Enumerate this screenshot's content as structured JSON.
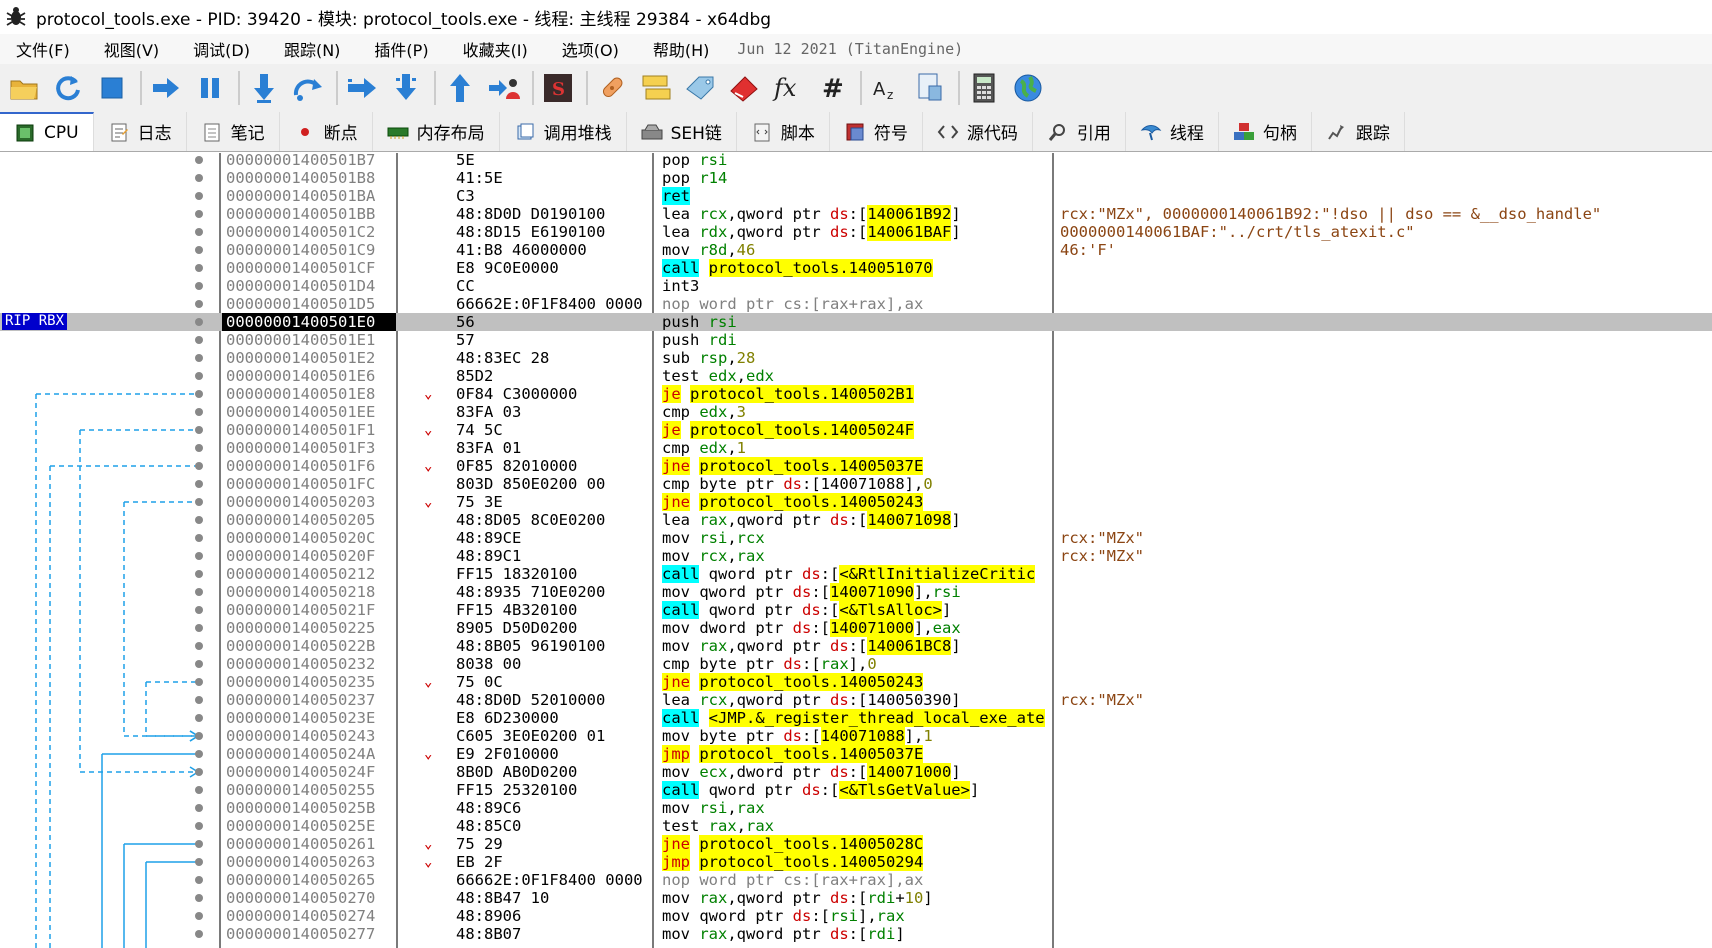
{
  "window": {
    "title": "protocol_tools.exe - PID: 39420 - 模块: protocol_tools.exe - 线程: 主线程 29384 - x64dbg"
  },
  "menu": {
    "items": [
      "文件(F)",
      "视图(V)",
      "调试(D)",
      "跟踪(N)",
      "插件(P)",
      "收藏夹(I)",
      "选项(O)",
      "帮助(H)"
    ],
    "build_info": "Jun 12 2021 (TitanEngine)"
  },
  "toolbar": {
    "icons": [
      "open-icon",
      "restart-icon",
      "stop-icon",
      "run-icon",
      "pause-icon",
      "step-into-icon",
      "step-over-icon",
      "run-to-user-icon",
      "step-into-trace-icon",
      "run-until-return-icon",
      "run-to-user-code-icon",
      "scylla-icon",
      "patch-icon",
      "comment-icon",
      "label-icon",
      "bookmark-icon",
      "function-icon",
      "hash-icon",
      "font-icon",
      "calculator-doc-icon",
      "calculator-icon",
      "globe-icon"
    ]
  },
  "tabs": [
    {
      "label": "CPU",
      "icon": "cpu-icon",
      "active": true
    },
    {
      "label": "日志",
      "icon": "log-icon"
    },
    {
      "label": "笔记",
      "icon": "notes-icon"
    },
    {
      "label": "断点",
      "icon": "breakpoint-icon"
    },
    {
      "label": "内存布局",
      "icon": "memory-icon"
    },
    {
      "label": "调用堆栈",
      "icon": "callstack-icon"
    },
    {
      "label": "SEH链",
      "icon": "seh-icon"
    },
    {
      "label": "脚本",
      "icon": "script-icon"
    },
    {
      "label": "符号",
      "icon": "symbol-icon"
    },
    {
      "label": "源代码",
      "icon": "source-icon"
    },
    {
      "label": "引用",
      "icon": "reference-icon"
    },
    {
      "label": "线程",
      "icon": "thread-icon"
    },
    {
      "label": "句柄",
      "icon": "handle-icon"
    },
    {
      "label": "跟踪",
      "icon": "trace-icon"
    }
  ],
  "rip_label": "RIP RBX",
  "disasm": [
    {
      "addr": "00000001400501B7",
      "bytes": "5E",
      "ins": [
        [
          "mn",
          "pop "
        ],
        [
          "reg",
          "rsi"
        ]
      ]
    },
    {
      "addr": "00000001400501B8",
      "bytes": "41:5E",
      "ins": [
        [
          "mn",
          "pop "
        ],
        [
          "reg",
          "r14"
        ]
      ]
    },
    {
      "addr": "00000001400501BA",
      "bytes": "C3",
      "ins": [
        [
          "ret",
          "ret"
        ]
      ]
    },
    {
      "addr": "00000001400501BB",
      "bytes": "48:8D0D D0190100",
      "ins": [
        [
          "mn",
          "lea "
        ],
        [
          "reg",
          "rcx"
        ],
        [
          "mn",
          ",qword ptr "
        ],
        [
          "seg",
          "ds"
        ],
        [
          "mn",
          ":["
        ],
        [
          "mem",
          "140061B92"
        ],
        [
          "mn",
          "]"
        ]
      ],
      "cmt": "rcx:\"MZx\", 0000000140061B92:\"!dso || dso == &__dso_handle\""
    },
    {
      "addr": "00000001400501C2",
      "bytes": "48:8D15 E6190100",
      "ins": [
        [
          "mn",
          "lea "
        ],
        [
          "reg",
          "rdx"
        ],
        [
          "mn",
          ",qword ptr "
        ],
        [
          "seg",
          "ds"
        ],
        [
          "mn",
          ":["
        ],
        [
          "mem",
          "140061BAF"
        ],
        [
          "mn",
          "]"
        ]
      ],
      "cmt": "0000000140061BAF:\"../crt/tls_atexit.c\""
    },
    {
      "addr": "00000001400501C9",
      "bytes": "41:B8 46000000",
      "ins": [
        [
          "mn",
          "mov "
        ],
        [
          "reg",
          "r8d"
        ],
        [
          "mn",
          ","
        ],
        [
          "num",
          "46"
        ]
      ],
      "cmt": "46:'F'"
    },
    {
      "addr": "00000001400501CF",
      "bytes": "E8 9C0E0000",
      "ins": [
        [
          "call",
          "call"
        ],
        [
          "mn",
          " "
        ],
        [
          "tgt",
          "protocol_tools.140051070"
        ]
      ]
    },
    {
      "addr": "00000001400501D4",
      "bytes": "CC",
      "ins": [
        [
          "mn",
          "int3"
        ]
      ]
    },
    {
      "addr": "00000001400501D5",
      "bytes": "66662E:0F1F8400 0000",
      "ins": [
        [
          "nop",
          "nop word ptr cs:[rax+rax],ax"
        ]
      ]
    },
    {
      "addr": "00000001400501E0",
      "bytes": "56",
      "ins": [
        [
          "mn",
          "push "
        ],
        [
          "reg",
          "rsi"
        ]
      ],
      "rip": true
    },
    {
      "addr": "00000001400501E1",
      "bytes": "57",
      "ins": [
        [
          "mn",
          "push "
        ],
        [
          "reg",
          "rdi"
        ]
      ]
    },
    {
      "addr": "00000001400501E2",
      "bytes": "48:83EC 28",
      "ins": [
        [
          "mn",
          "sub "
        ],
        [
          "reg",
          "rsp"
        ],
        [
          "mn",
          ","
        ],
        [
          "num",
          "28"
        ]
      ]
    },
    {
      "addr": "00000001400501E6",
      "bytes": "85D2",
      "ins": [
        [
          "mn",
          "test "
        ],
        [
          "reg",
          "edx"
        ],
        [
          "mn",
          ","
        ],
        [
          "reg",
          "edx"
        ]
      ]
    },
    {
      "addr": "00000001400501E8",
      "bytes": "0F84 C3000000",
      "ins": [
        [
          "j",
          "je"
        ],
        [
          "mn",
          " "
        ],
        [
          "tgt",
          "protocol_tools.1400502B1"
        ]
      ],
      "jmp": true
    },
    {
      "addr": "00000001400501EE",
      "bytes": "83FA 03",
      "ins": [
        [
          "mn",
          "cmp "
        ],
        [
          "reg",
          "edx"
        ],
        [
          "mn",
          ","
        ],
        [
          "num",
          "3"
        ]
      ]
    },
    {
      "addr": "00000001400501F1",
      "bytes": "74 5C",
      "ins": [
        [
          "j",
          "je"
        ],
        [
          "mn",
          " "
        ],
        [
          "tgt",
          "protocol_tools.14005024F"
        ]
      ],
      "jmp": true
    },
    {
      "addr": "00000001400501F3",
      "bytes": "83FA 01",
      "ins": [
        [
          "mn",
          "cmp "
        ],
        [
          "reg",
          "edx"
        ],
        [
          "mn",
          ","
        ],
        [
          "num",
          "1"
        ]
      ]
    },
    {
      "addr": "00000001400501F6",
      "bytes": "0F85 82010000",
      "ins": [
        [
          "j",
          "jne"
        ],
        [
          "mn",
          " "
        ],
        [
          "tgt",
          "protocol_tools.14005037E"
        ]
      ],
      "jmp": true
    },
    {
      "addr": "00000001400501FC",
      "bytes": "803D 850E0200 00",
      "ins": [
        [
          "mn",
          "cmp byte ptr "
        ],
        [
          "seg",
          "ds"
        ],
        [
          "mn",
          ":[140071088],"
        ],
        [
          "num",
          "0"
        ]
      ]
    },
    {
      "addr": "0000000140050203",
      "bytes": "75 3E",
      "ins": [
        [
          "j",
          "jne"
        ],
        [
          "mn",
          " "
        ],
        [
          "tgt",
          "protocol_tools.140050243"
        ]
      ],
      "jmp": true
    },
    {
      "addr": "0000000140050205",
      "bytes": "48:8D05 8C0E0200",
      "ins": [
        [
          "mn",
          "lea "
        ],
        [
          "reg",
          "rax"
        ],
        [
          "mn",
          ",qword ptr "
        ],
        [
          "seg",
          "ds"
        ],
        [
          "mn",
          ":["
        ],
        [
          "mem",
          "140071098"
        ],
        [
          "mn",
          "]"
        ]
      ]
    },
    {
      "addr": "000000014005020C",
      "bytes": "48:89CE",
      "ins": [
        [
          "mn",
          "mov "
        ],
        [
          "reg",
          "rsi"
        ],
        [
          "mn",
          ","
        ],
        [
          "reg",
          "rcx"
        ]
      ],
      "cmt": "rcx:\"MZx\""
    },
    {
      "addr": "000000014005020F",
      "bytes": "48:89C1",
      "ins": [
        [
          "mn",
          "mov "
        ],
        [
          "reg",
          "rcx"
        ],
        [
          "mn",
          ","
        ],
        [
          "reg",
          "rax"
        ]
      ],
      "cmt": "rcx:\"MZx\""
    },
    {
      "addr": "0000000140050212",
      "bytes": "FF15 18320100",
      "ins": [
        [
          "call",
          "call"
        ],
        [
          "mn",
          " qword ptr "
        ],
        [
          "seg",
          "ds"
        ],
        [
          "mn",
          ":["
        ],
        [
          "mem",
          "<&RtlInitializeCritic"
        ]
      ]
    },
    {
      "addr": "0000000140050218",
      "bytes": "48:8935 710E0200",
      "ins": [
        [
          "mn",
          "mov qword ptr "
        ],
        [
          "seg",
          "ds"
        ],
        [
          "mn",
          ":["
        ],
        [
          "mem",
          "140071090"
        ],
        [
          "mn",
          "],"
        ],
        [
          "reg",
          "rsi"
        ]
      ]
    },
    {
      "addr": "000000014005021F",
      "bytes": "FF15 4B320100",
      "ins": [
        [
          "call",
          "call"
        ],
        [
          "mn",
          " qword ptr "
        ],
        [
          "seg",
          "ds"
        ],
        [
          "mn",
          ":["
        ],
        [
          "mem",
          "<&TlsAlloc>"
        ],
        [
          "mn",
          "]"
        ]
      ]
    },
    {
      "addr": "0000000140050225",
      "bytes": "8905 D50D0200",
      "ins": [
        [
          "mn",
          "mov dword ptr "
        ],
        [
          "seg",
          "ds"
        ],
        [
          "mn",
          ":["
        ],
        [
          "mem",
          "140071000"
        ],
        [
          "mn",
          "],"
        ],
        [
          "reg",
          "eax"
        ]
      ]
    },
    {
      "addr": "000000014005022B",
      "bytes": "48:8B05 96190100",
      "ins": [
        [
          "mn",
          "mov "
        ],
        [
          "reg",
          "rax"
        ],
        [
          "mn",
          ",qword ptr "
        ],
        [
          "seg",
          "ds"
        ],
        [
          "mn",
          ":["
        ],
        [
          "mem",
          "140061BC8"
        ],
        [
          "mn",
          "]"
        ]
      ]
    },
    {
      "addr": "0000000140050232",
      "bytes": "8038 00",
      "ins": [
        [
          "mn",
          "cmp byte ptr "
        ],
        [
          "seg",
          "ds"
        ],
        [
          "mn",
          ":["
        ],
        [
          "reg",
          "rax"
        ],
        [
          "mn",
          "],"
        ],
        [
          "num",
          "0"
        ]
      ]
    },
    {
      "addr": "0000000140050235",
      "bytes": "75 0C",
      "ins": [
        [
          "j",
          "jne"
        ],
        [
          "mn",
          " "
        ],
        [
          "tgt",
          "protocol_tools.140050243"
        ]
      ],
      "jmp": true
    },
    {
      "addr": "0000000140050237",
      "bytes": "48:8D0D 52010000",
      "ins": [
        [
          "mn",
          "lea "
        ],
        [
          "reg",
          "rcx"
        ],
        [
          "mn",
          ",qword ptr "
        ],
        [
          "seg",
          "ds"
        ],
        [
          "mn",
          ":[140050390]"
        ]
      ],
      "cmt": "rcx:\"MZx\""
    },
    {
      "addr": "000000014005023E",
      "bytes": "E8 6D230000",
      "ins": [
        [
          "call",
          "call"
        ],
        [
          "mn",
          " "
        ],
        [
          "tgt",
          "<JMP.&_register_thread_local_exe_ate"
        ]
      ]
    },
    {
      "addr": "0000000140050243",
      "bytes": "C605 3E0E0200 01",
      "ins": [
        [
          "mn",
          "mov byte ptr "
        ],
        [
          "seg",
          "ds"
        ],
        [
          "mn",
          ":["
        ],
        [
          "mem",
          "140071088"
        ],
        [
          "mn",
          "],"
        ],
        [
          "num",
          "1"
        ]
      ]
    },
    {
      "addr": "000000014005024A",
      "bytes": "E9 2F010000",
      "ins": [
        [
          "j",
          "jmp"
        ],
        [
          "mn",
          " "
        ],
        [
          "tgt",
          "protocol_tools.14005037E"
        ]
      ],
      "jmp": true
    },
    {
      "addr": "000000014005024F",
      "bytes": "8B0D AB0D0200",
      "ins": [
        [
          "mn",
          "mov "
        ],
        [
          "reg",
          "ecx"
        ],
        [
          "mn",
          ",dword ptr "
        ],
        [
          "seg",
          "ds"
        ],
        [
          "mn",
          ":["
        ],
        [
          "mem",
          "140071000"
        ],
        [
          "mn",
          "]"
        ]
      ]
    },
    {
      "addr": "0000000140050255",
      "bytes": "FF15 25320100",
      "ins": [
        [
          "call",
          "call"
        ],
        [
          "mn",
          " qword ptr "
        ],
        [
          "seg",
          "ds"
        ],
        [
          "mn",
          ":["
        ],
        [
          "mem",
          "<&TlsGetValue>"
        ],
        [
          "mn",
          "]"
        ]
      ]
    },
    {
      "addr": "000000014005025B",
      "bytes": "48:89C6",
      "ins": [
        [
          "mn",
          "mov "
        ],
        [
          "reg",
          "rsi"
        ],
        [
          "mn",
          ","
        ],
        [
          "reg",
          "rax"
        ]
      ]
    },
    {
      "addr": "000000014005025E",
      "bytes": "48:85C0",
      "ins": [
        [
          "mn",
          "test "
        ],
        [
          "reg",
          "rax"
        ],
        [
          "mn",
          ","
        ],
        [
          "reg",
          "rax"
        ]
      ]
    },
    {
      "addr": "0000000140050261",
      "bytes": "75 29",
      "ins": [
        [
          "j",
          "jne"
        ],
        [
          "mn",
          " "
        ],
        [
          "tgt",
          "protocol_tools.14005028C"
        ]
      ],
      "jmp": true
    },
    {
      "addr": "0000000140050263",
      "bytes": "EB 2F",
      "ins": [
        [
          "j",
          "jmp"
        ],
        [
          "mn",
          " "
        ],
        [
          "tgt",
          "protocol_tools.140050294"
        ]
      ],
      "jmp": true
    },
    {
      "addr": "0000000140050265",
      "bytes": "66662E:0F1F8400 0000",
      "ins": [
        [
          "nop",
          "nop word ptr cs:[rax+rax],ax"
        ]
      ]
    },
    {
      "addr": "0000000140050270",
      "bytes": "48:8B47 10",
      "ins": [
        [
          "mn",
          "mov "
        ],
        [
          "reg",
          "rax"
        ],
        [
          "mn",
          ",qword ptr "
        ],
        [
          "seg",
          "ds"
        ],
        [
          "mn",
          ":["
        ],
        [
          "reg",
          "rdi"
        ],
        [
          "mn",
          "+"
        ],
        [
          "num",
          "10"
        ],
        [
          "mn",
          "]"
        ]
      ]
    },
    {
      "addr": "0000000140050274",
      "bytes": "48:8906",
      "ins": [
        [
          "mn",
          "mov qword ptr "
        ],
        [
          "seg",
          "ds"
        ],
        [
          "mn",
          ":["
        ],
        [
          "reg",
          "rsi"
        ],
        [
          "mn",
          "],"
        ],
        [
          "reg",
          "rax"
        ]
      ]
    },
    {
      "addr": "0000000140050277",
      "bytes": "48:8B07",
      "ins": [
        [
          "mn",
          "mov "
        ],
        [
          "reg",
          "rax"
        ],
        [
          "mn",
          ",qword ptr "
        ],
        [
          "seg",
          "ds"
        ],
        [
          "mn",
          ":["
        ],
        [
          "reg",
          "rdi"
        ],
        [
          "mn",
          "]"
        ]
      ]
    }
  ]
}
